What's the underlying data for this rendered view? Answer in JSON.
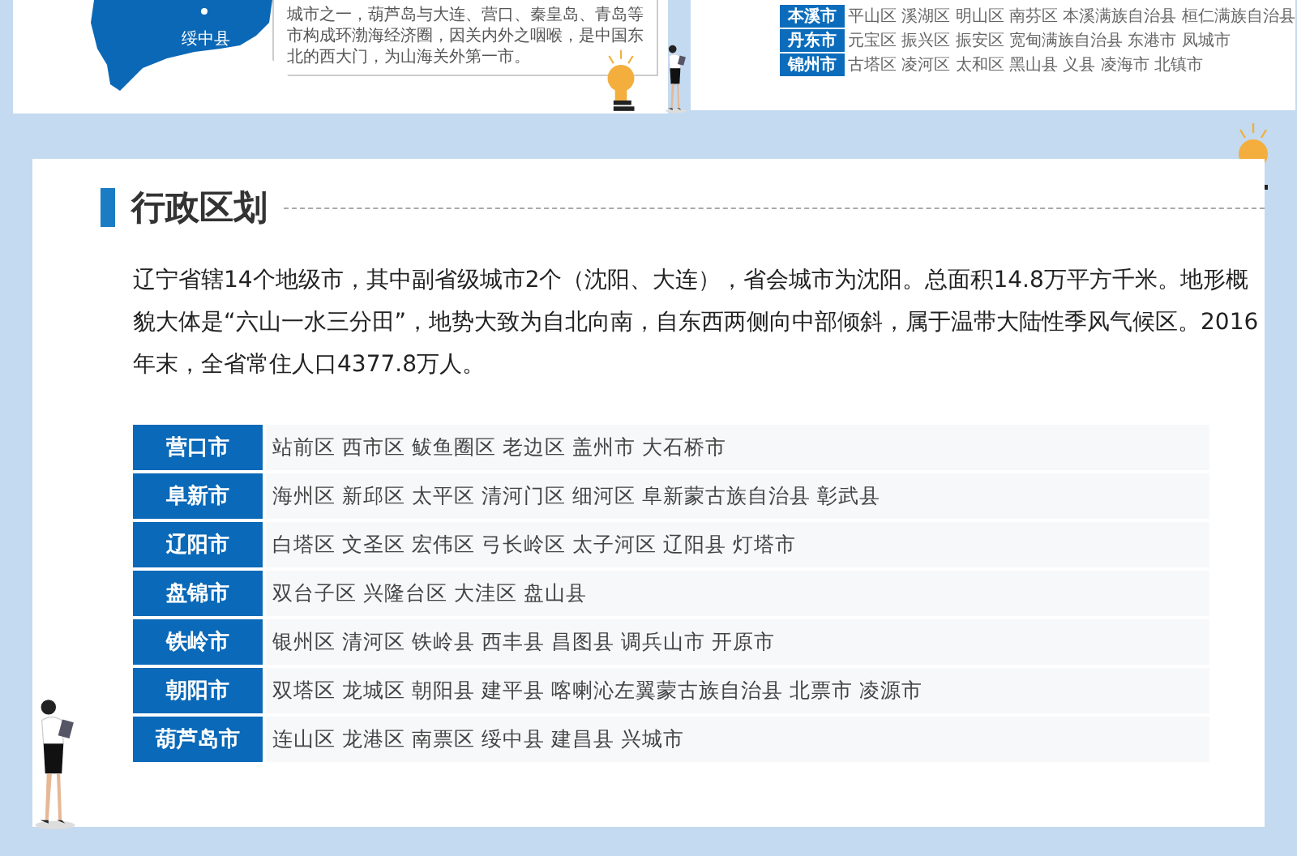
{
  "top_left_card": {
    "map_label": "绥中县",
    "callout": [
      "城市之一，葫芦岛与大连、营口、秦皇岛、青岛等",
      "市构成环渤海经济圈，因关内外之咽喉，是中国东",
      "北的西大门，为山海关外第一市。"
    ]
  },
  "top_right_card": {
    "rows": [
      {
        "city": "本溪市",
        "districts": "平山区 溪湖区 明山区 南芬区 本溪满族自治县 桓仁满族自治县"
      },
      {
        "city": "丹东市",
        "districts": "元宝区 振兴区 振安区 宽甸满族自治县 东港市 凤城市"
      },
      {
        "city": "锦州市",
        "districts": "古塔区 凌河区 太和区 黑山县 义县 凌海市 北镇市"
      }
    ]
  },
  "section": {
    "title": "行政区划",
    "paragraph": "辽宁省辖14个地级市，其中副省级城市2个（沈阳、大连），省会城市为沈阳。总面积14.8万平方千米。地形概貌大体是“六山一水三分田”，地势大致为自北向南，自东西两侧向中部倾斜，属于温带大陆性季风气候区。2016年末，全省常住人口4377.8万人。",
    "rows": [
      {
        "city": "营口市",
        "districts": "站前区 西市区 鲅鱼圈区 老边区 盖州市 大石桥市"
      },
      {
        "city": "阜新市",
        "districts": "海州区 新邱区 太平区 清河门区 细河区 阜新蒙古族自治县 彰武县"
      },
      {
        "city": "辽阳市",
        "districts": "白塔区 文圣区 宏伟区 弓长岭区 太子河区 辽阳县 灯塔市"
      },
      {
        "city": "盘锦市",
        "districts": "双台子区 兴隆台区 大洼区 盘山县"
      },
      {
        "city": "铁岭市",
        "districts": "银州区 清河区 铁岭县 西丰县 昌图县 调兵山市 开原市"
      },
      {
        "city": "朝阳市",
        "districts": "双塔区 龙城区 朝阳县 建平县 喀喇沁左翼蒙古族自治县 北票市 凌源市"
      },
      {
        "city": "葫芦岛市",
        "districts": "连山区 龙港区 南票区 绥中县 建昌县 兴城市"
      }
    ]
  }
}
